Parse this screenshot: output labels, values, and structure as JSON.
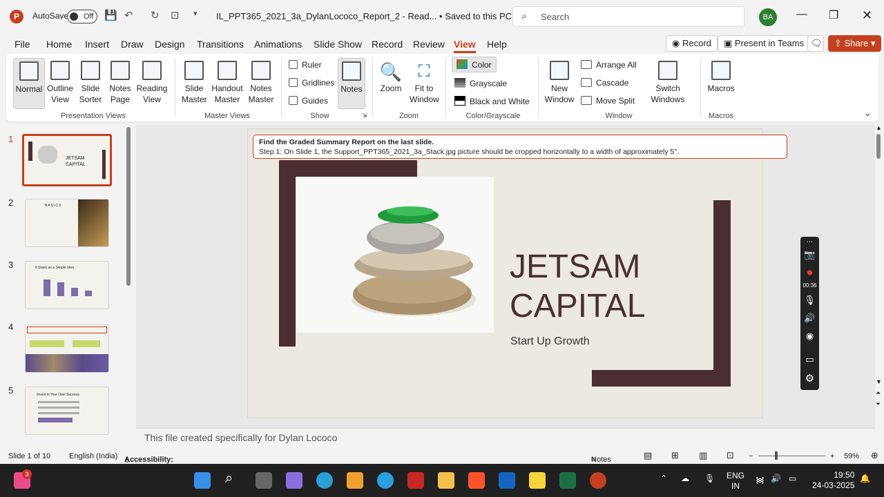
{
  "titlebar": {
    "autosave_label": "AutoSave",
    "autosave_state": "Off",
    "doc_title": "IL_PPT365_2021_3a_DylanLococo_Report_2  -  Read...  •  Saved to this PC",
    "search_placeholder": "Search",
    "avatar_initials": "BA"
  },
  "menu": {
    "tabs": [
      "File",
      "Home",
      "Insert",
      "Draw",
      "Design",
      "Transitions",
      "Animations",
      "Slide Show",
      "Record",
      "Review",
      "View",
      "Help"
    ],
    "active": "View",
    "record_btn": "Record",
    "present_btn": "Present in Teams",
    "share_btn": "Share"
  },
  "ribbon": {
    "presentation_views": {
      "label": "Presentation Views",
      "buttons": [
        "Normal",
        "Outline View",
        "Slide Sorter",
        "Notes Page",
        "Reading View"
      ]
    },
    "master_views": {
      "label": "Master Views",
      "buttons": [
        "Slide Master",
        "Handout Master",
        "Notes Master"
      ]
    },
    "show": {
      "label": "Show",
      "checks": [
        "Ruler",
        "Gridlines",
        "Guides"
      ],
      "notes_btn": "Notes"
    },
    "zoom": {
      "label": "Zoom",
      "buttons": [
        "Zoom",
        "Fit to Window"
      ]
    },
    "color": {
      "label": "Color/Grayscale",
      "options": [
        "Color",
        "Grayscale",
        "Black and White"
      ]
    },
    "window": {
      "label": "Window",
      "new_window": "New Window",
      "items": [
        "Arrange All",
        "Cascade",
        "Move Split"
      ],
      "switch": "Switch Windows"
    },
    "macros": {
      "label": "Macros",
      "btn": "Macros"
    }
  },
  "thumbnails": [
    {
      "n": "1",
      "title": "JETSAM CAPITAL"
    },
    {
      "n": "2",
      "title": "BASICS"
    },
    {
      "n": "3",
      "title": "It Starts as a Simple Idea"
    },
    {
      "n": "4",
      "title": ""
    },
    {
      "n": "5",
      "title": "Invest in Your Own Success"
    }
  ],
  "slide": {
    "notice_title": "Find the Graded Summary Report on the last slide.",
    "notice_step": "Step 1: On Slide 1, the Support_PPT365_2021_3a_Stack.jpg picture should be cropped horizontally to a width of approximately 5\".",
    "title_line1": "JETSAM",
    "title_line2": "CAPITAL",
    "subtitle": "Start Up Growth"
  },
  "notes_text": "This file created specifically for Dylan Lococo",
  "status": {
    "slide_count": "Slide 1 of 10",
    "language": "English (India)",
    "accessibility": "Accessibility: Investigate",
    "notes": "Notes",
    "zoom": "59%"
  },
  "recorder": {
    "timer": "00:36"
  },
  "taskbar": {
    "lang1": "ENG",
    "lang2": "IN",
    "time": "19:50",
    "date": "24-03-2025",
    "notification_badge": "3"
  }
}
